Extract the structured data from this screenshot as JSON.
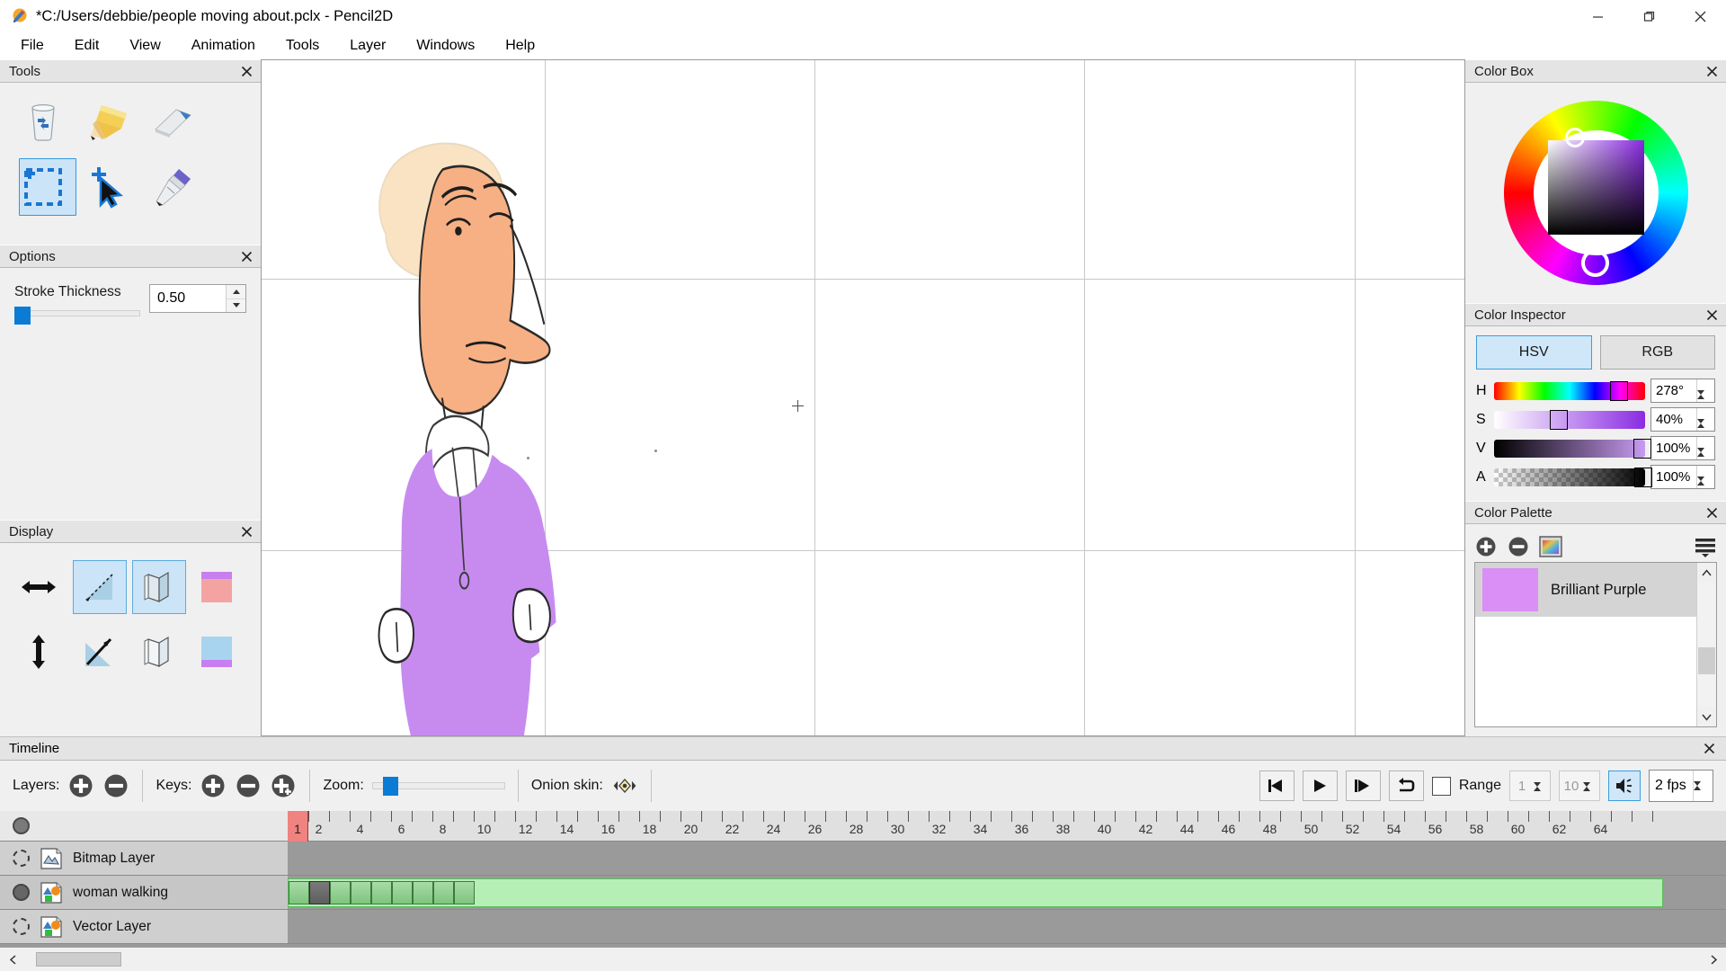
{
  "window": {
    "title": "*C:/Users/debbie/people moving about.pclx - Pencil2D",
    "minimize": "minimize-icon",
    "maximize": "maximize-icon",
    "close": "close-icon"
  },
  "menu": {
    "items": [
      "File",
      "Edit",
      "View",
      "Animation",
      "Tools",
      "Layer",
      "Windows",
      "Help"
    ]
  },
  "tools_panel": {
    "title": "Tools",
    "close": "×",
    "tools": [
      {
        "name": "clear-tool",
        "icon": "trash-icon",
        "active": false
      },
      {
        "name": "pencil-tool",
        "icon": "pencil-icon",
        "active": false
      },
      {
        "name": "eraser-tool",
        "icon": "eraser-icon",
        "active": false
      },
      {
        "name": "select-tool",
        "icon": "select-rectangle-icon",
        "active": true
      },
      {
        "name": "move-tool",
        "icon": "move-arrow-icon",
        "active": false
      },
      {
        "name": "pen-tool",
        "icon": "pen-nib-icon",
        "active": false
      }
    ]
  },
  "options_panel": {
    "title": "Options",
    "close": "×",
    "stroke_thickness_label": "Stroke Thickness",
    "stroke_thickness_value": "0.50"
  },
  "display_panel": {
    "title": "Display",
    "close": "×",
    "controls": [
      {
        "name": "flip-horizontal",
        "icon": "arrows-horizontal-icon",
        "active": false
      },
      {
        "name": "onion-skin-previous",
        "icon": "onion-prev-icon",
        "active": true
      },
      {
        "name": "onion-skin-next",
        "icon": "onion-pages-icon",
        "active": true
      },
      {
        "name": "onion-color-red",
        "icon": "color-swatch-red-icon",
        "active": false
      },
      {
        "name": "flip-vertical",
        "icon": "arrows-vertical-icon",
        "active": false
      },
      {
        "name": "onion-skin-mode",
        "icon": "onion-next-icon",
        "active": false
      },
      {
        "name": "onion-skin-frames",
        "icon": "onion-pages-alt-icon",
        "active": false
      },
      {
        "name": "onion-color-blue",
        "icon": "color-swatch-blue-icon",
        "active": false
      }
    ]
  },
  "color_box": {
    "title": "Color Box",
    "close": "×",
    "wheel": "color-wheel",
    "selected_color": "#cf87f2"
  },
  "color_inspector": {
    "title": "Color Inspector",
    "close": "×",
    "tabs": [
      {
        "label": "HSV",
        "active": true
      },
      {
        "label": "RGB",
        "active": false
      }
    ],
    "channels": [
      {
        "label": "H",
        "value": "278°",
        "pos": 77
      },
      {
        "label": "S",
        "value": "40%",
        "pos": 37
      },
      {
        "label": "V",
        "value": "100%",
        "pos": 94
      },
      {
        "label": "A",
        "value": "100%",
        "pos": 95
      }
    ]
  },
  "color_palette": {
    "title": "Color Palette",
    "close": "×",
    "buttons": [
      {
        "name": "add-color-button",
        "icon": "plus-circle-icon"
      },
      {
        "name": "remove-color-button",
        "icon": "minus-circle-icon"
      },
      {
        "name": "palette-preview-button",
        "icon": "palette-grid-icon"
      },
      {
        "name": "palette-menu-button",
        "icon": "hamburger-menu-icon"
      }
    ],
    "swatches": [
      {
        "name": "Brilliant Purple",
        "color": "#d98ff5",
        "selected": true
      }
    ]
  },
  "timeline": {
    "title": "Timeline",
    "close": "×",
    "layers_label": "Layers:",
    "layer_add": "add-layer-icon",
    "layer_remove": "remove-layer-icon",
    "keys_label": "Keys:",
    "key_add": "add-key-icon",
    "key_remove": "remove-key-icon",
    "key_duplicate": "duplicate-key-icon",
    "zoom_label": "Zoom:",
    "onion_label": "Onion skin:",
    "onion_icon": "onion-skin-toggle-icon",
    "playback": {
      "prev_frame": "previous-frame-icon",
      "play": "play-icon",
      "next_frame": "next-frame-icon",
      "loop": "loop-icon",
      "range_label": "Range",
      "range_checked": false,
      "range_start": "1",
      "range_end": "10",
      "sound": "sound-icon",
      "sound_active": true,
      "fps": "2 fps"
    },
    "ruler": {
      "current_frame": "1",
      "labels": [
        "2",
        "4",
        "6",
        "8",
        "10",
        "12",
        "14",
        "16",
        "18",
        "20",
        "22",
        "24",
        "26",
        "28",
        "30",
        "32",
        "34",
        "36",
        "38",
        "40",
        "42",
        "44",
        "46",
        "48",
        "50",
        "52",
        "54",
        "56",
        "58",
        "60",
        "62",
        "64"
      ]
    },
    "layers": [
      {
        "name": "Bitmap Layer",
        "icon": "bitmap-layer-icon",
        "visible": false,
        "selected": false,
        "keyframes": [],
        "track_green": false
      },
      {
        "name": "woman walking",
        "icon": "vector-layer-icon",
        "visible": true,
        "selected": true,
        "keyframes": [
          1,
          2,
          3,
          4,
          5,
          6,
          7,
          8,
          9
        ],
        "selected_key": 2,
        "track_green": true
      },
      {
        "name": "Vector Layer",
        "icon": "vector-layer-icon",
        "visible": false,
        "selected": false,
        "keyframes": [],
        "track_green": false
      }
    ]
  },
  "canvas": {
    "name": "drawing-canvas",
    "artwork_description": "woman walking character sketch",
    "colors": {
      "hair": "#fae3c3",
      "skin": "#f7b083",
      "shirt": "#c78bf0",
      "outline": "#1a1a1a"
    }
  }
}
